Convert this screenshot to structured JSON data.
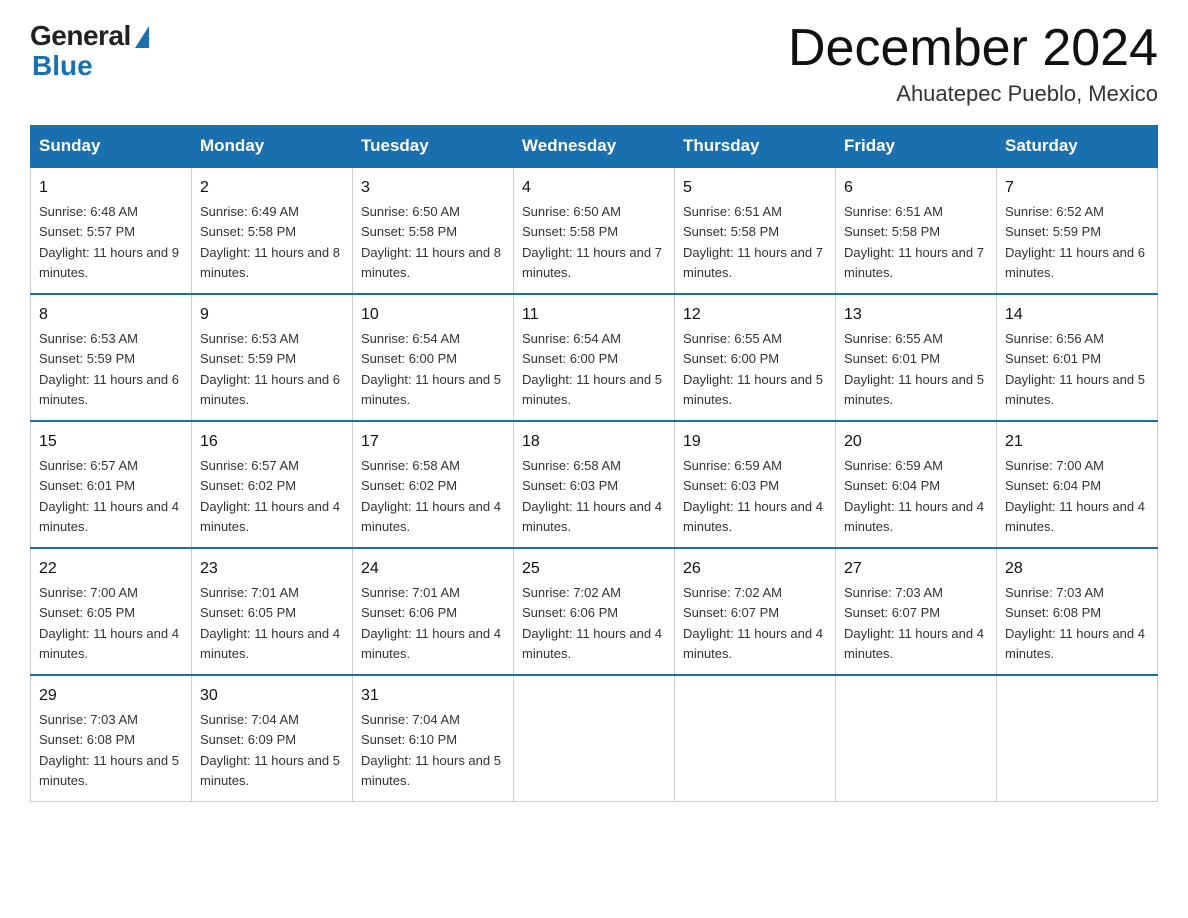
{
  "logo": {
    "general": "General",
    "blue": "Blue"
  },
  "header": {
    "title": "December 2024",
    "subtitle": "Ahuatepec Pueblo, Mexico"
  },
  "days_of_week": [
    "Sunday",
    "Monday",
    "Tuesday",
    "Wednesday",
    "Thursday",
    "Friday",
    "Saturday"
  ],
  "weeks": [
    [
      {
        "num": "1",
        "sunrise": "6:48 AM",
        "sunset": "5:57 PM",
        "daylight": "11 hours and 9 minutes."
      },
      {
        "num": "2",
        "sunrise": "6:49 AM",
        "sunset": "5:58 PM",
        "daylight": "11 hours and 8 minutes."
      },
      {
        "num": "3",
        "sunrise": "6:50 AM",
        "sunset": "5:58 PM",
        "daylight": "11 hours and 8 minutes."
      },
      {
        "num": "4",
        "sunrise": "6:50 AM",
        "sunset": "5:58 PM",
        "daylight": "11 hours and 7 minutes."
      },
      {
        "num": "5",
        "sunrise": "6:51 AM",
        "sunset": "5:58 PM",
        "daylight": "11 hours and 7 minutes."
      },
      {
        "num": "6",
        "sunrise": "6:51 AM",
        "sunset": "5:58 PM",
        "daylight": "11 hours and 7 minutes."
      },
      {
        "num": "7",
        "sunrise": "6:52 AM",
        "sunset": "5:59 PM",
        "daylight": "11 hours and 6 minutes."
      }
    ],
    [
      {
        "num": "8",
        "sunrise": "6:53 AM",
        "sunset": "5:59 PM",
        "daylight": "11 hours and 6 minutes."
      },
      {
        "num": "9",
        "sunrise": "6:53 AM",
        "sunset": "5:59 PM",
        "daylight": "11 hours and 6 minutes."
      },
      {
        "num": "10",
        "sunrise": "6:54 AM",
        "sunset": "6:00 PM",
        "daylight": "11 hours and 5 minutes."
      },
      {
        "num": "11",
        "sunrise": "6:54 AM",
        "sunset": "6:00 PM",
        "daylight": "11 hours and 5 minutes."
      },
      {
        "num": "12",
        "sunrise": "6:55 AM",
        "sunset": "6:00 PM",
        "daylight": "11 hours and 5 minutes."
      },
      {
        "num": "13",
        "sunrise": "6:55 AM",
        "sunset": "6:01 PM",
        "daylight": "11 hours and 5 minutes."
      },
      {
        "num": "14",
        "sunrise": "6:56 AM",
        "sunset": "6:01 PM",
        "daylight": "11 hours and 5 minutes."
      }
    ],
    [
      {
        "num": "15",
        "sunrise": "6:57 AM",
        "sunset": "6:01 PM",
        "daylight": "11 hours and 4 minutes."
      },
      {
        "num": "16",
        "sunrise": "6:57 AM",
        "sunset": "6:02 PM",
        "daylight": "11 hours and 4 minutes."
      },
      {
        "num": "17",
        "sunrise": "6:58 AM",
        "sunset": "6:02 PM",
        "daylight": "11 hours and 4 minutes."
      },
      {
        "num": "18",
        "sunrise": "6:58 AM",
        "sunset": "6:03 PM",
        "daylight": "11 hours and 4 minutes."
      },
      {
        "num": "19",
        "sunrise": "6:59 AM",
        "sunset": "6:03 PM",
        "daylight": "11 hours and 4 minutes."
      },
      {
        "num": "20",
        "sunrise": "6:59 AM",
        "sunset": "6:04 PM",
        "daylight": "11 hours and 4 minutes."
      },
      {
        "num": "21",
        "sunrise": "7:00 AM",
        "sunset": "6:04 PM",
        "daylight": "11 hours and 4 minutes."
      }
    ],
    [
      {
        "num": "22",
        "sunrise": "7:00 AM",
        "sunset": "6:05 PM",
        "daylight": "11 hours and 4 minutes."
      },
      {
        "num": "23",
        "sunrise": "7:01 AM",
        "sunset": "6:05 PM",
        "daylight": "11 hours and 4 minutes."
      },
      {
        "num": "24",
        "sunrise": "7:01 AM",
        "sunset": "6:06 PM",
        "daylight": "11 hours and 4 minutes."
      },
      {
        "num": "25",
        "sunrise": "7:02 AM",
        "sunset": "6:06 PM",
        "daylight": "11 hours and 4 minutes."
      },
      {
        "num": "26",
        "sunrise": "7:02 AM",
        "sunset": "6:07 PM",
        "daylight": "11 hours and 4 minutes."
      },
      {
        "num": "27",
        "sunrise": "7:03 AM",
        "sunset": "6:07 PM",
        "daylight": "11 hours and 4 minutes."
      },
      {
        "num": "28",
        "sunrise": "7:03 AM",
        "sunset": "6:08 PM",
        "daylight": "11 hours and 4 minutes."
      }
    ],
    [
      {
        "num": "29",
        "sunrise": "7:03 AM",
        "sunset": "6:08 PM",
        "daylight": "11 hours and 5 minutes."
      },
      {
        "num": "30",
        "sunrise": "7:04 AM",
        "sunset": "6:09 PM",
        "daylight": "11 hours and 5 minutes."
      },
      {
        "num": "31",
        "sunrise": "7:04 AM",
        "sunset": "6:10 PM",
        "daylight": "11 hours and 5 minutes."
      },
      null,
      null,
      null,
      null
    ]
  ]
}
